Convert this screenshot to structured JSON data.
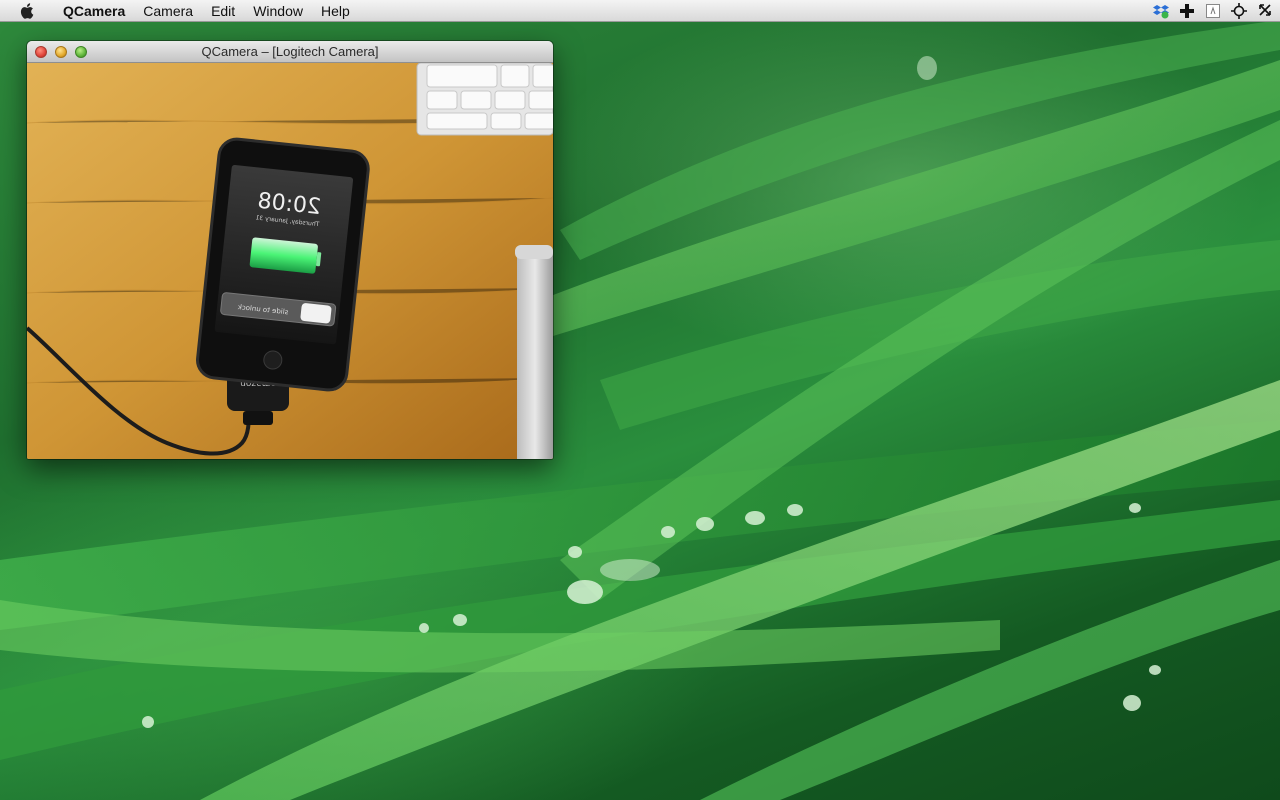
{
  "menubar": {
    "apple_icon": "apple-logo-icon",
    "items": [
      {
        "label": "QCamera"
      },
      {
        "label": "Camera"
      },
      {
        "label": "Edit"
      },
      {
        "label": "Window"
      },
      {
        "label": "Help"
      }
    ],
    "status_icons": [
      "dropbox-icon",
      "plus-cross-icon",
      "text-input-icon",
      "crosshair-icon",
      "arrows-icon"
    ]
  },
  "window": {
    "title": "QCamera – [Logitech Camera]",
    "camera_feed": {
      "phone_clock": "20:08",
      "phone_date": "Thursday, January 31",
      "phone_unlock": "slide to unlock",
      "cable_brand": "amazon"
    }
  },
  "colors": {
    "wallpaper_green": "#1f6f2f",
    "desk_wood": "#c98f2e",
    "battery_green": "#4cff7a"
  }
}
